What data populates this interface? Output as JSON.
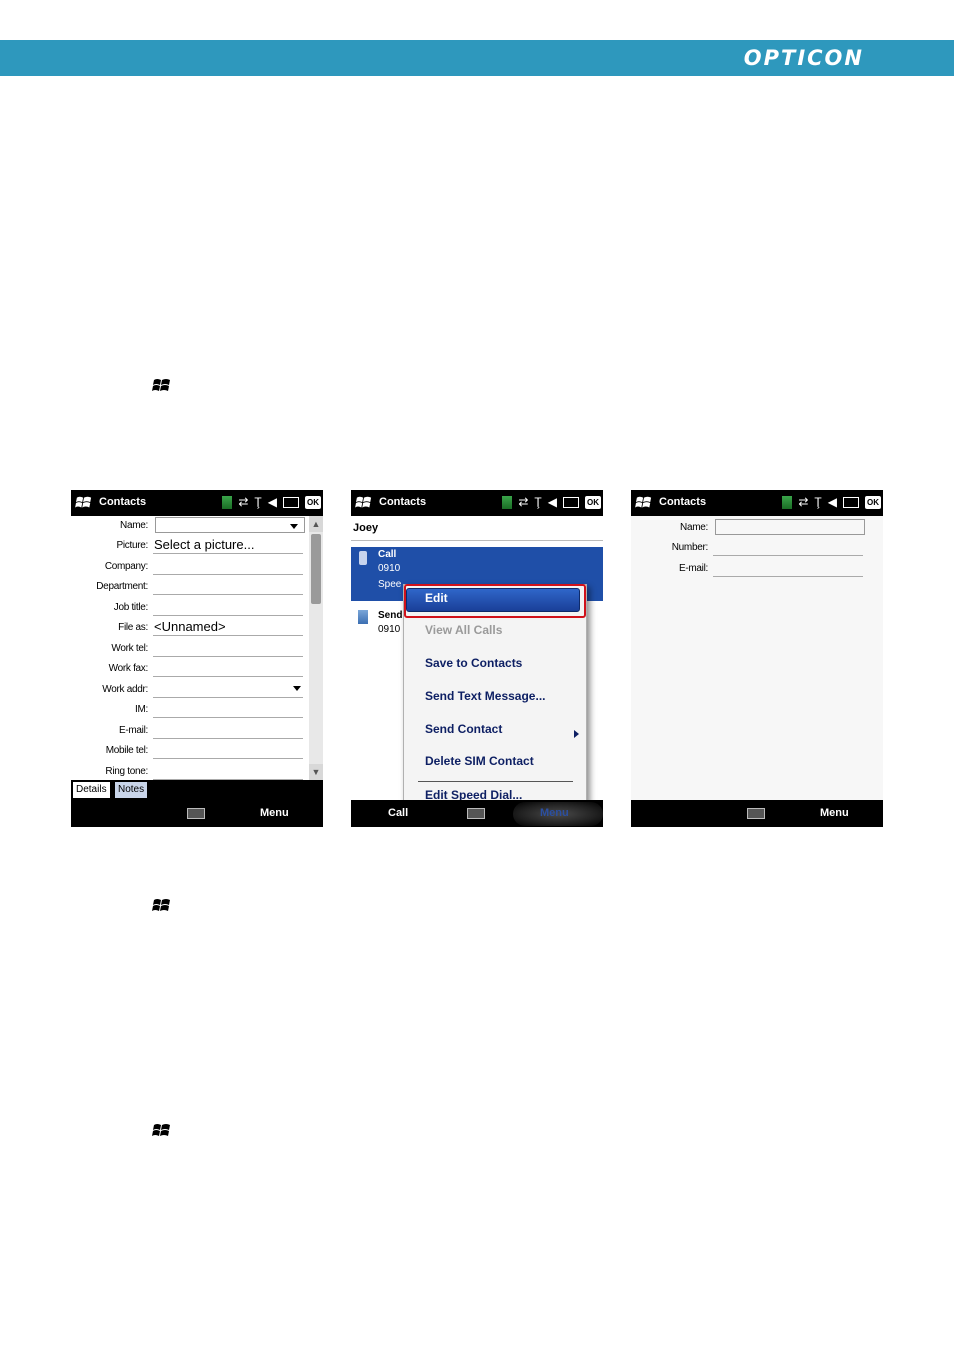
{
  "header": {
    "brand": "OPTICON"
  },
  "screens": [
    {
      "title": "Contacts",
      "fields": [
        {
          "label": "Name:",
          "value": ""
        },
        {
          "label": "Picture:",
          "value": "Select a picture..."
        },
        {
          "label": "Company:",
          "value": ""
        },
        {
          "label": "Department:",
          "value": ""
        },
        {
          "label": "Job title:",
          "value": ""
        },
        {
          "label": "File as:",
          "value": "<Unnamed>"
        },
        {
          "label": "Work tel:",
          "value": ""
        },
        {
          "label": "Work fax:",
          "value": ""
        },
        {
          "label": "Work addr:",
          "value": ""
        },
        {
          "label": "IM:",
          "value": ""
        },
        {
          "label": "E-mail:",
          "value": ""
        },
        {
          "label": "Mobile tel:",
          "value": ""
        },
        {
          "label": "Ring tone:",
          "value": ""
        }
      ],
      "tabs": [
        "Details",
        "Notes"
      ],
      "softkey_right": "Menu"
    },
    {
      "title": "Contacts",
      "contact_name": "Joey",
      "rows": [
        {
          "title": "Call",
          "line1": "0910",
          "line2": "Spee"
        },
        {
          "title": "Send",
          "line1": "0910"
        }
      ],
      "menu_items": [
        {
          "label": "Edit",
          "enabled": true,
          "selected": true
        },
        {
          "label": "View All Calls",
          "enabled": false
        },
        {
          "label": "Save to Contacts",
          "enabled": true
        },
        {
          "label": "Send Text Message...",
          "enabled": true
        },
        {
          "label": "Send Contact",
          "enabled": true,
          "submenu": true
        },
        {
          "label": "Delete SIM Contact",
          "enabled": true
        },
        {
          "label": "Edit Speed Dial...",
          "enabled": true
        }
      ],
      "softkey_left": "Call",
      "softkey_right": "Menu"
    },
    {
      "title": "Contacts",
      "fields": [
        {
          "label": "Name:",
          "value": ""
        },
        {
          "label": "Number:",
          "value": ""
        },
        {
          "label": "E-mail:",
          "value": ""
        }
      ],
      "softkey_right": "Menu"
    }
  ],
  "colors": {
    "banner": "#2e98bd",
    "menu_text": "#0d1f63",
    "selection": "#1f4fa8",
    "highlight_frame": "#d0121b"
  }
}
